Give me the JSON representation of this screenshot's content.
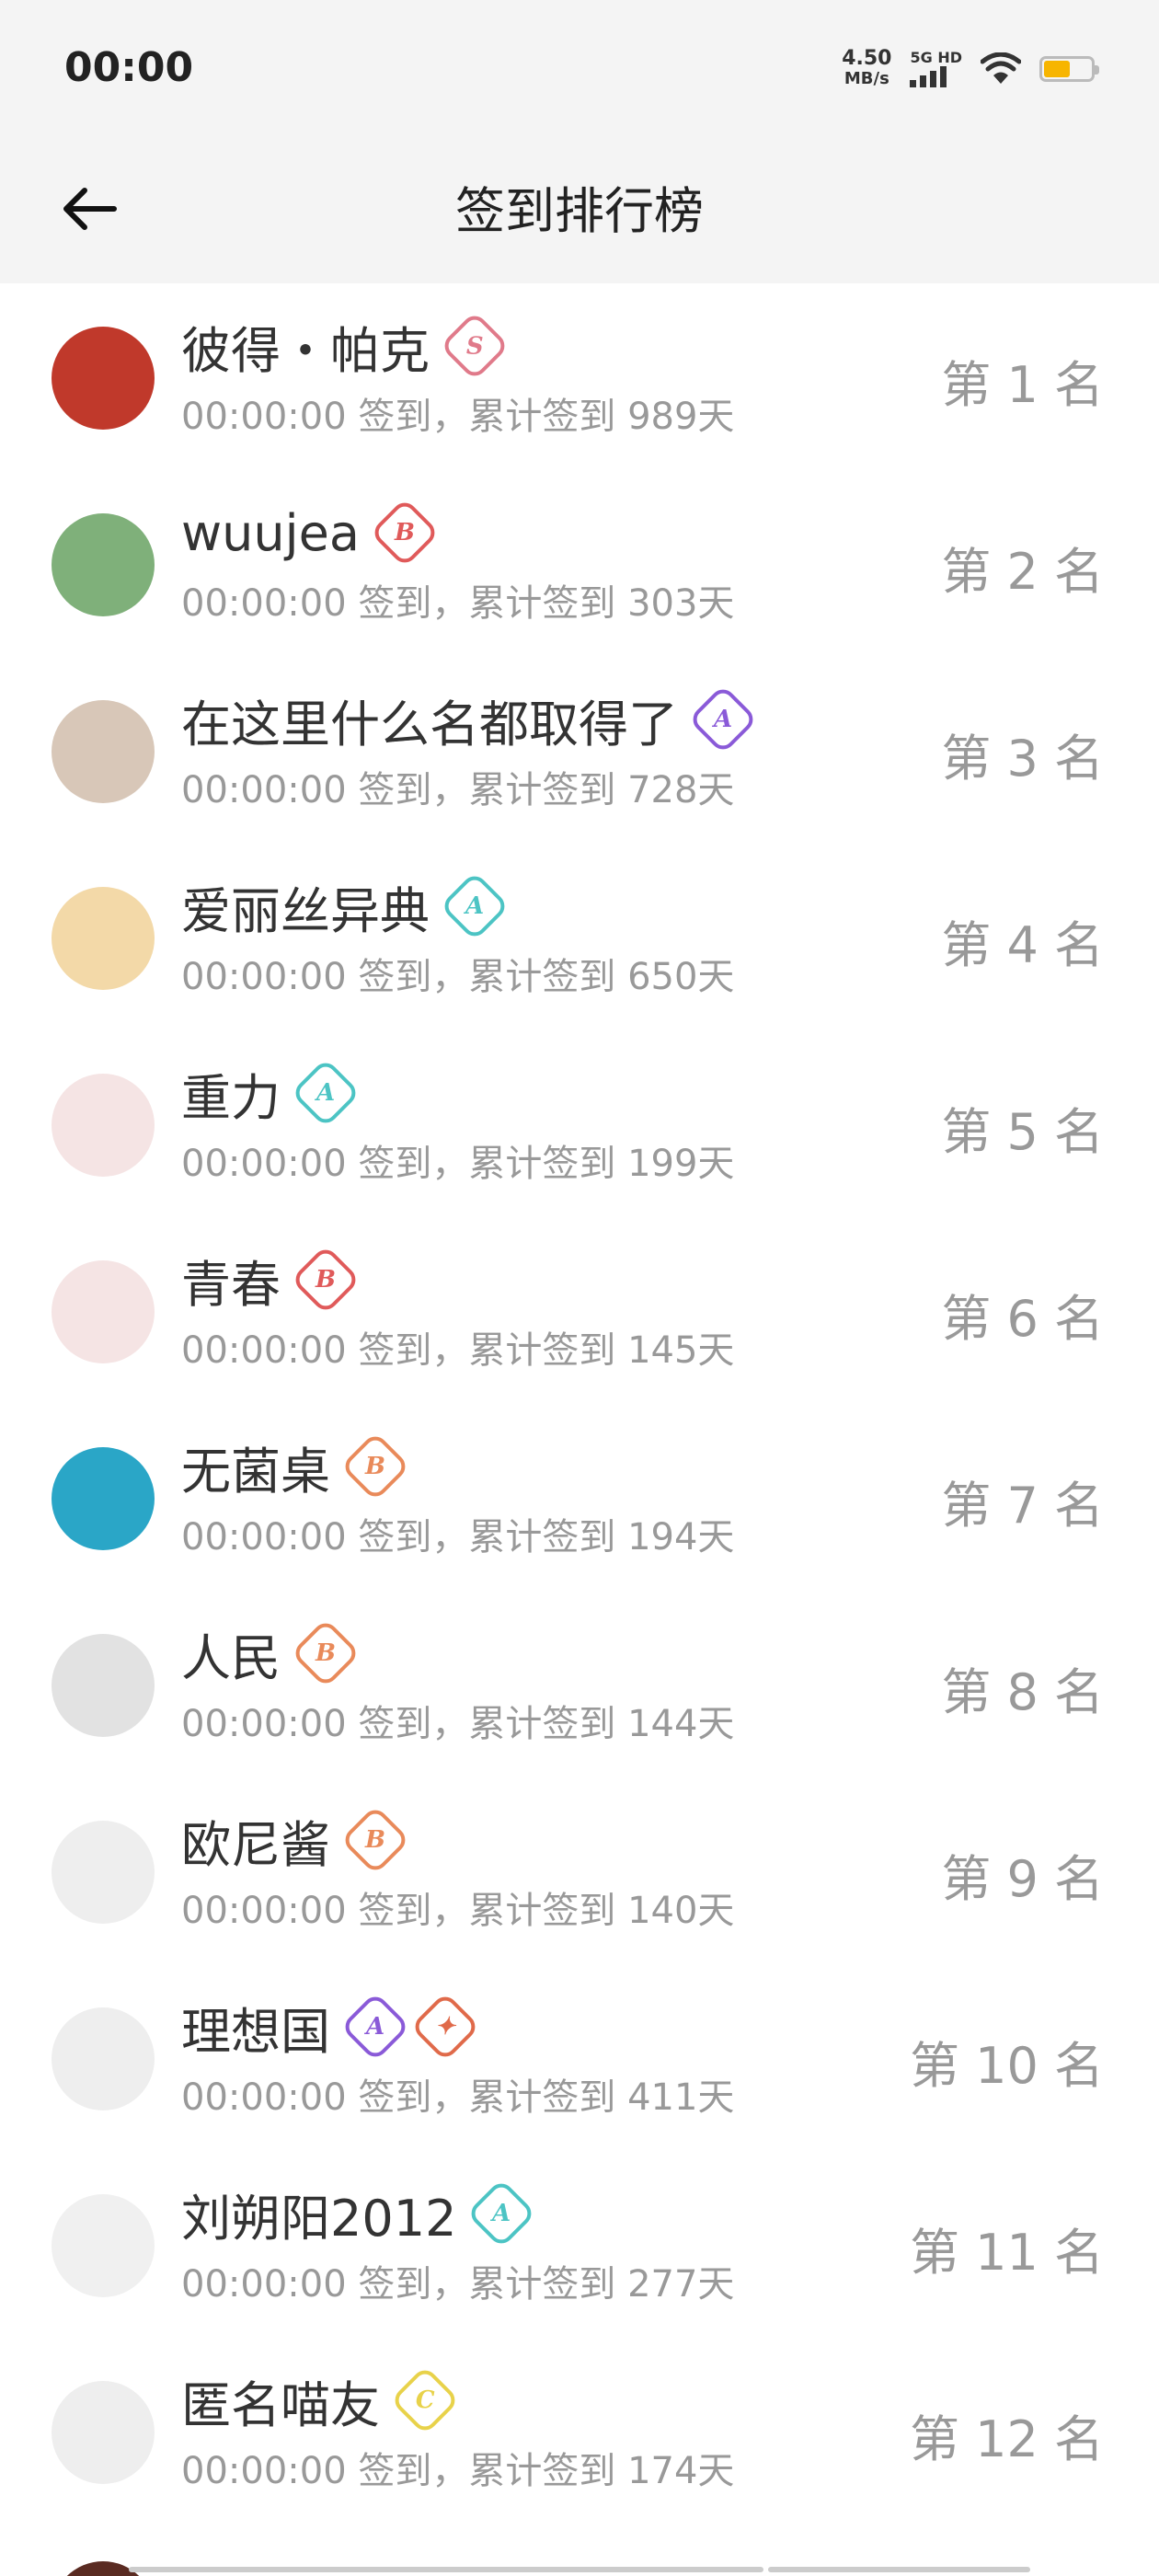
{
  "status_bar": {
    "time": "00:00",
    "net_speed_value": "4.50",
    "net_speed_unit": "MB/s",
    "signal_label": "5G HD",
    "battery_level": 0.55
  },
  "header": {
    "title": "签到排行榜",
    "back_icon": "arrow-left-icon"
  },
  "rows": [
    {
      "name": "彼得・帕克",
      "sub": "00:00:00 签到，累计签到 989天",
      "rank": "第 1 名",
      "badges": [
        {
          "letter": "S",
          "color": "#e07a8a"
        }
      ]
    },
    {
      "name": "wuujea",
      "sub": "00:00:00 签到，累计签到 303天",
      "rank": "第 2 名",
      "badges": [
        {
          "letter": "B",
          "color": "#e05a5a"
        }
      ]
    },
    {
      "name": "在这里什么名都取得了",
      "sub": "00:00:00 签到，累计签到 728天",
      "rank": "第 3 名",
      "badges": [
        {
          "letter": "A",
          "color": "#8a5ad8"
        }
      ]
    },
    {
      "name": "爱丽丝异典",
      "sub": "00:00:00 签到，累计签到 650天",
      "rank": "第 4 名",
      "badges": [
        {
          "letter": "A",
          "color": "#4cc4c4"
        }
      ]
    },
    {
      "name": "重力",
      "sub": "00:00:00 签到，累计签到 199天",
      "rank": "第 5 名",
      "badges": [
        {
          "letter": "A",
          "color": "#4cc4c4"
        }
      ]
    },
    {
      "name": "青春",
      "sub": "00:00:00 签到，累计签到 145天",
      "rank": "第 6 名",
      "badges": [
        {
          "letter": "B",
          "color": "#e05a5a"
        }
      ]
    },
    {
      "name": "无菌桌",
      "sub": "00:00:00 签到，累计签到 194天",
      "rank": "第 7 名",
      "badges": [
        {
          "letter": "B",
          "color": "#e98a5a"
        }
      ]
    },
    {
      "name": "人民",
      "sub": "00:00:00 签到，累计签到 144天",
      "rank": "第 8 名",
      "badges": [
        {
          "letter": "B",
          "color": "#e98a5a"
        }
      ]
    },
    {
      "name": "欧尼酱",
      "sub": "00:00:00 签到，累计签到 140天",
      "rank": "第 9 名",
      "badges": [
        {
          "letter": "B",
          "color": "#e98a5a"
        }
      ]
    },
    {
      "name": "理想国",
      "sub": "00:00:00 签到，累计签到 411天",
      "rank": "第 10 名",
      "badges": [
        {
          "letter": "A",
          "color": "#8a5ad8"
        },
        {
          "letter": "✦",
          "color": "#e06a4a"
        }
      ]
    },
    {
      "name": "刘朔阳2012",
      "sub": "00:00:00 签到，累计签到 277天",
      "rank": "第 11 名",
      "badges": [
        {
          "letter": "A",
          "color": "#4cc4c4"
        }
      ]
    },
    {
      "name": "匿名喵友",
      "sub": "00:00:00 签到，累计签到 174天",
      "rank": "第 12 名",
      "badges": [
        {
          "letter": "C",
          "color": "#e8d24a"
        }
      ]
    }
  ],
  "avatar_colors": [
    "#c0392b",
    "#7fb07a",
    "#d8c7b8",
    "#f3d9a8",
    "#f5e4e4",
    "#f5e4e4",
    "#2aa6c7",
    "#e2e2e2",
    "#eeeeee",
    "#eeeeee",
    "#f0f0f0",
    "#eeeeee"
  ]
}
